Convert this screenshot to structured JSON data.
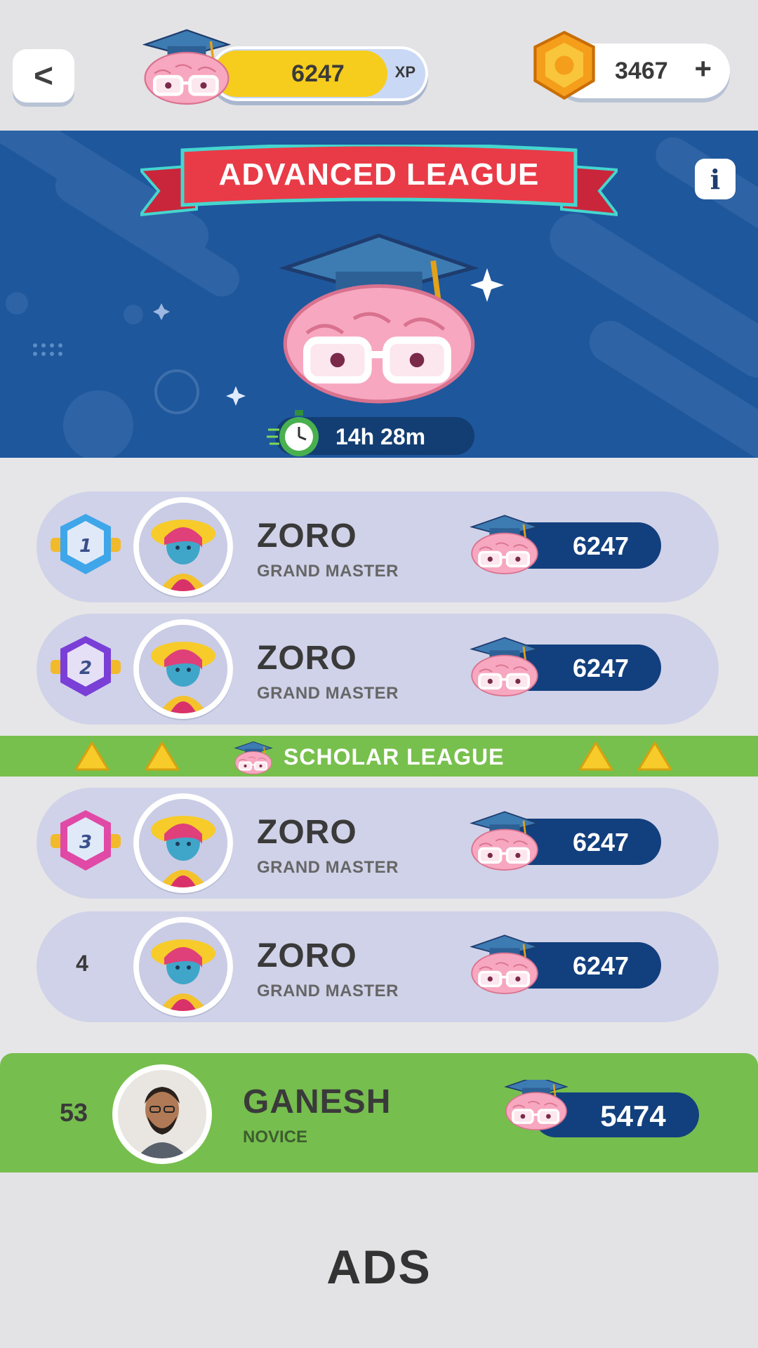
{
  "header": {
    "back_label": "<",
    "xp_value": "6247",
    "xp_unit": "XP",
    "xp_progress": 0.82,
    "coins": "3467",
    "add_coins_label": "+"
  },
  "banner": {
    "title": "ADVANCED LEAGUE",
    "info_label": "i",
    "timer": "14h 28m"
  },
  "leaderboard": {
    "rows": [
      {
        "rank": "1",
        "name": "ZORO",
        "title": "GRAND MASTER",
        "score": "6247"
      },
      {
        "rank": "2",
        "name": "ZORO",
        "title": "GRAND MASTER",
        "score": "6247"
      },
      {
        "rank": "3",
        "name": "ZORO",
        "title": "GRAND MASTER",
        "score": "6247"
      },
      {
        "rank": "4",
        "name": "ZORO",
        "title": "GRAND MASTER",
        "score": "6247"
      }
    ],
    "divider_label": "SCHOLAR LEAGUE",
    "me": {
      "rank": "53",
      "name": "GANESH",
      "title": "NOVICE",
      "score": "5474"
    }
  },
  "ads_label": "ADS",
  "colors": {
    "banner": "#1e579b",
    "row": "#cfd2e8",
    "score_pill": "#123f7d",
    "promotion_bar": "#78c04e",
    "xp_fill": "#f7cd1d",
    "badge_1": "#3fa6ea",
    "badge_2": "#7a3fd6",
    "badge_3": "#e04aa6"
  },
  "icons": {
    "back": "chevron-left-icon",
    "mascot": "brain-graduate-icon",
    "coin": "gold-coin-icon",
    "info": "info-icon",
    "timer": "stopwatch-icon",
    "promote": "arrow-up-icon"
  }
}
